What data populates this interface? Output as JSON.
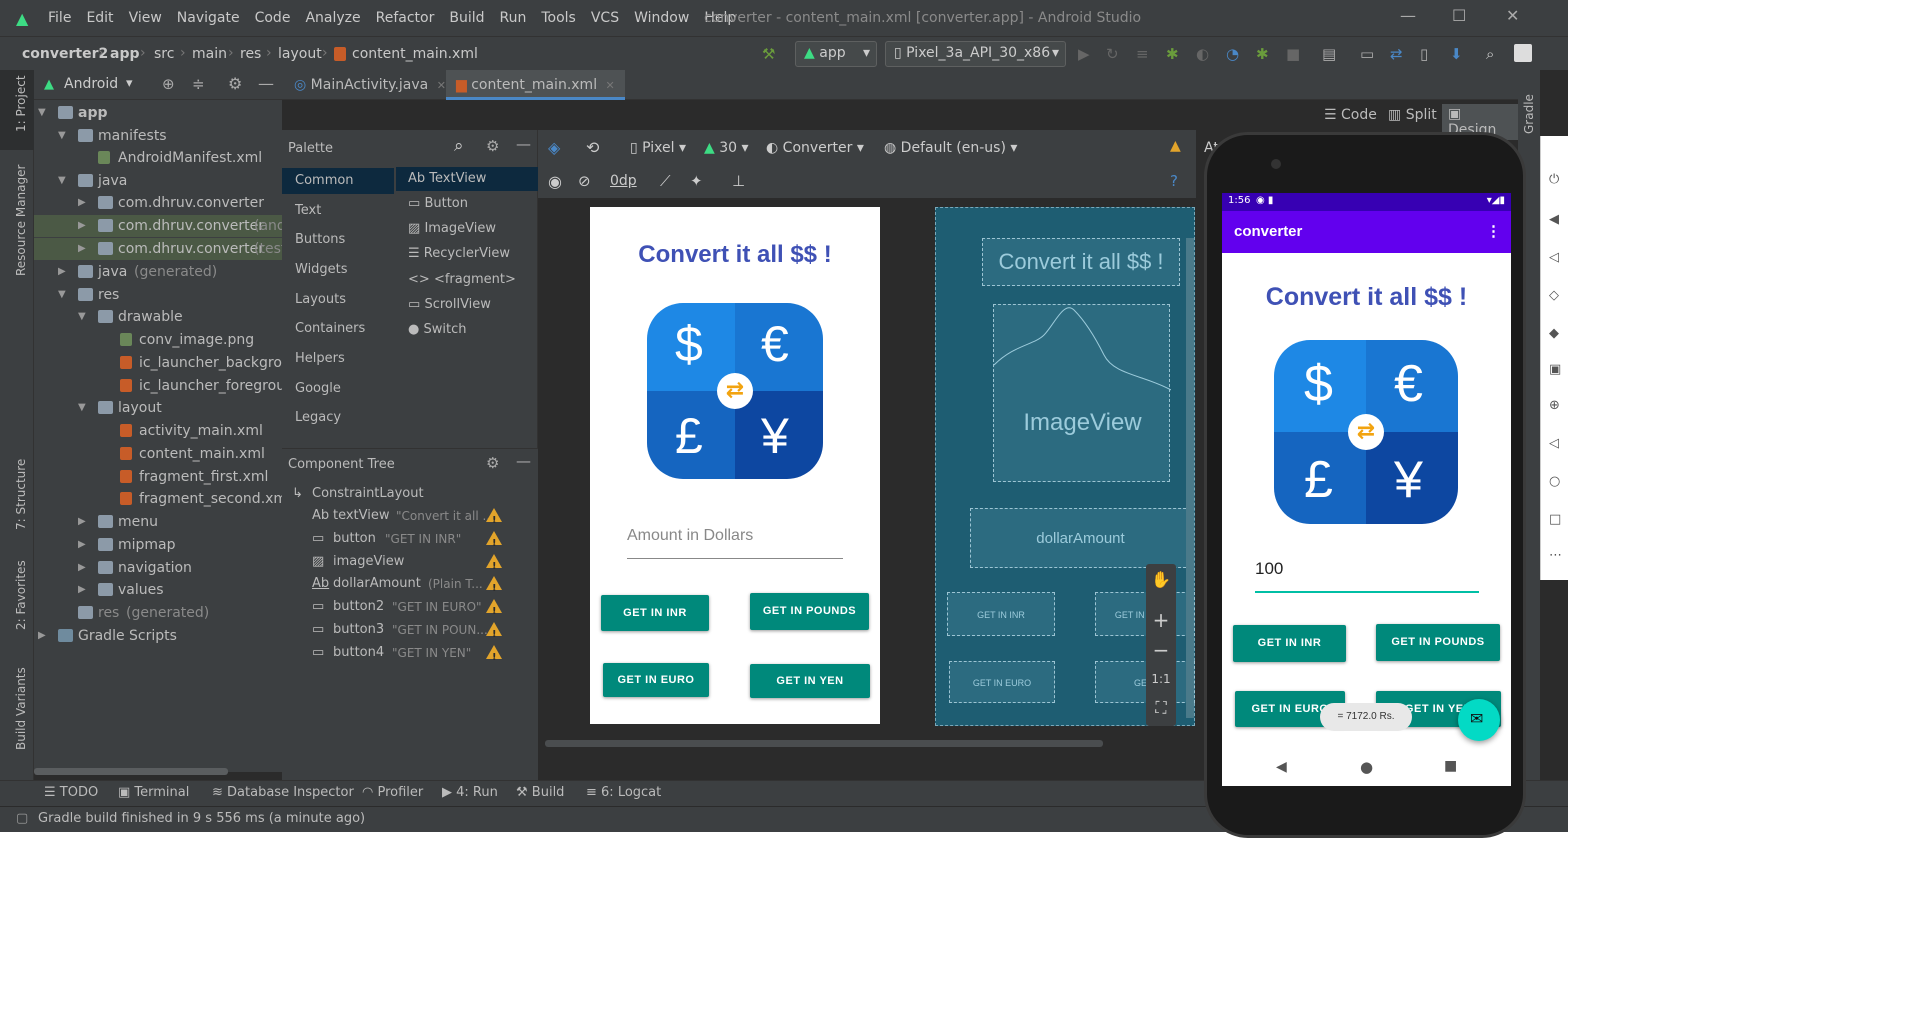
{
  "menu": [
    "File",
    "Edit",
    "View",
    "Navigate",
    "Code",
    "Analyze",
    "Refactor",
    "Build",
    "Run",
    "Tools",
    "VCS",
    "Window",
    "Help"
  ],
  "window_title": "converter - content_main.xml [converter.app] - Android Studio",
  "breadcrumb": [
    "converter2",
    "app",
    "src",
    "main",
    "res",
    "layout",
    "content_main.xml"
  ],
  "run_config": "app",
  "device": "Pixel_3a_API_30_x86",
  "project_view": "Android",
  "editor_tabs": [
    "MainActivity.java",
    "content_main.xml"
  ],
  "view_modes": {
    "code": "Code",
    "split": "Split",
    "design": "Design"
  },
  "tree": {
    "app": "app",
    "manifests": "manifests",
    "manifest_file": "AndroidManifest.xml",
    "java": "java",
    "pkg1": "com.dhruv.converter",
    "pkg2": "com.dhruv.converter",
    "pkg2_suffix": "(andr",
    "pkg3": "com.dhruv.converter",
    "pkg3_suffix": "(test)",
    "java_gen": "java",
    "java_gen_suffix": "(generated)",
    "res": "res",
    "drawable": "drawable",
    "conv_image": "conv_image.png",
    "ic_bg": "ic_launcher_backgroun",
    "ic_fg": "ic_launcher_foregrounc",
    "layout": "layout",
    "activity_main": "activity_main.xml",
    "content_main": "content_main.xml",
    "fragment_first": "fragment_first.xml",
    "fragment_second": "fragment_second.xml",
    "menu": "menu",
    "mipmap": "mipmap",
    "navigation": "navigation",
    "values": "values",
    "res_gen": "res",
    "res_gen_suffix": "(generated)",
    "gradle": "Gradle Scripts"
  },
  "left_stripe": {
    "project": "1: Project",
    "resource": "Resource Manager",
    "structure": "7: Structure",
    "favorites": "2: Favorites",
    "variants": "Build Variants"
  },
  "right_stripe": {
    "gradle": "Gradle"
  },
  "palette": {
    "title": "Palette",
    "categories": [
      "Common",
      "Text",
      "Buttons",
      "Widgets",
      "Layouts",
      "Containers",
      "Helpers",
      "Google",
      "Legacy"
    ],
    "items": [
      "TextView",
      "Button",
      "ImageView",
      "RecyclerView",
      "<fragment>",
      "ScrollView",
      "Switch"
    ],
    "items_prefix": [
      "Ab",
      "",
      "",
      "",
      "<>",
      "",
      ""
    ]
  },
  "component_tree": {
    "title": "Component Tree",
    "root": "ConstraintLayout",
    "rows": [
      {
        "name": "textView",
        "hint": "\"Convert it all ...",
        "prefix": "Ab"
      },
      {
        "name": "button",
        "hint": "\"GET IN INR\"",
        "prefix": ""
      },
      {
        "name": "imageView",
        "hint": "",
        "prefix": ""
      },
      {
        "name": "dollarAmount",
        "hint": "(Plain T...",
        "prefix": "Ab"
      },
      {
        "name": "button2",
        "hint": "\"GET IN EURO\"",
        "prefix": ""
      },
      {
        "name": "button3",
        "hint": "\"GET IN POUN...",
        "prefix": ""
      },
      {
        "name": "button4",
        "hint": "\"GET IN YEN\"",
        "prefix": ""
      }
    ]
  },
  "canvas_toolbar": {
    "device": "Pixel",
    "api": "30",
    "theme": "Converter",
    "locale": "Default (en-us)",
    "margin": "0dp",
    "attributes": "Att"
  },
  "design": {
    "title": "Convert it all $$ !",
    "hint": "Amount in Dollars",
    "btn_inr": "GET IN INR",
    "btn_pounds": "GET IN POUNDS",
    "btn_euro": "GET IN EURO",
    "btn_yen": "GET IN YEN",
    "symbols": [
      "$",
      "€",
      "£",
      "¥"
    ]
  },
  "blueprint": {
    "title": "Convert it all $$ !",
    "image": "ImageView",
    "amount": "dollarAmount",
    "btn_inr": "GET IN INR",
    "btn_pounds": "GET IN PO   DS",
    "btn_euro": "GET IN EURO",
    "btn_yen": "GE    N"
  },
  "zoom": {
    "plus": "+",
    "minus": "−",
    "one": "1:1"
  },
  "bottom_tools": [
    "TODO",
    "Terminal",
    "Database Inspector",
    "Profiler",
    "4: Run",
    "Build",
    "6: Logcat"
  ],
  "status_text": "Gradle build finished in 9 s 556 ms (a minute ago)",
  "emulator": {
    "time": "1:56",
    "app_name": "converter",
    "title": "Convert it all $$ !",
    "amount": "100",
    "btn_inr": "GET IN INR",
    "btn_pounds": "GET IN POUNDS",
    "btn_euro": "GET IN EURO",
    "btn_yen": "GET IN YEN",
    "toast": "= 7172.0 Rs."
  },
  "colors": {
    "brand_blue": "#3f51b5",
    "teal": "#00897b",
    "purple": "#6200ee",
    "warning": "#e2a42b"
  }
}
